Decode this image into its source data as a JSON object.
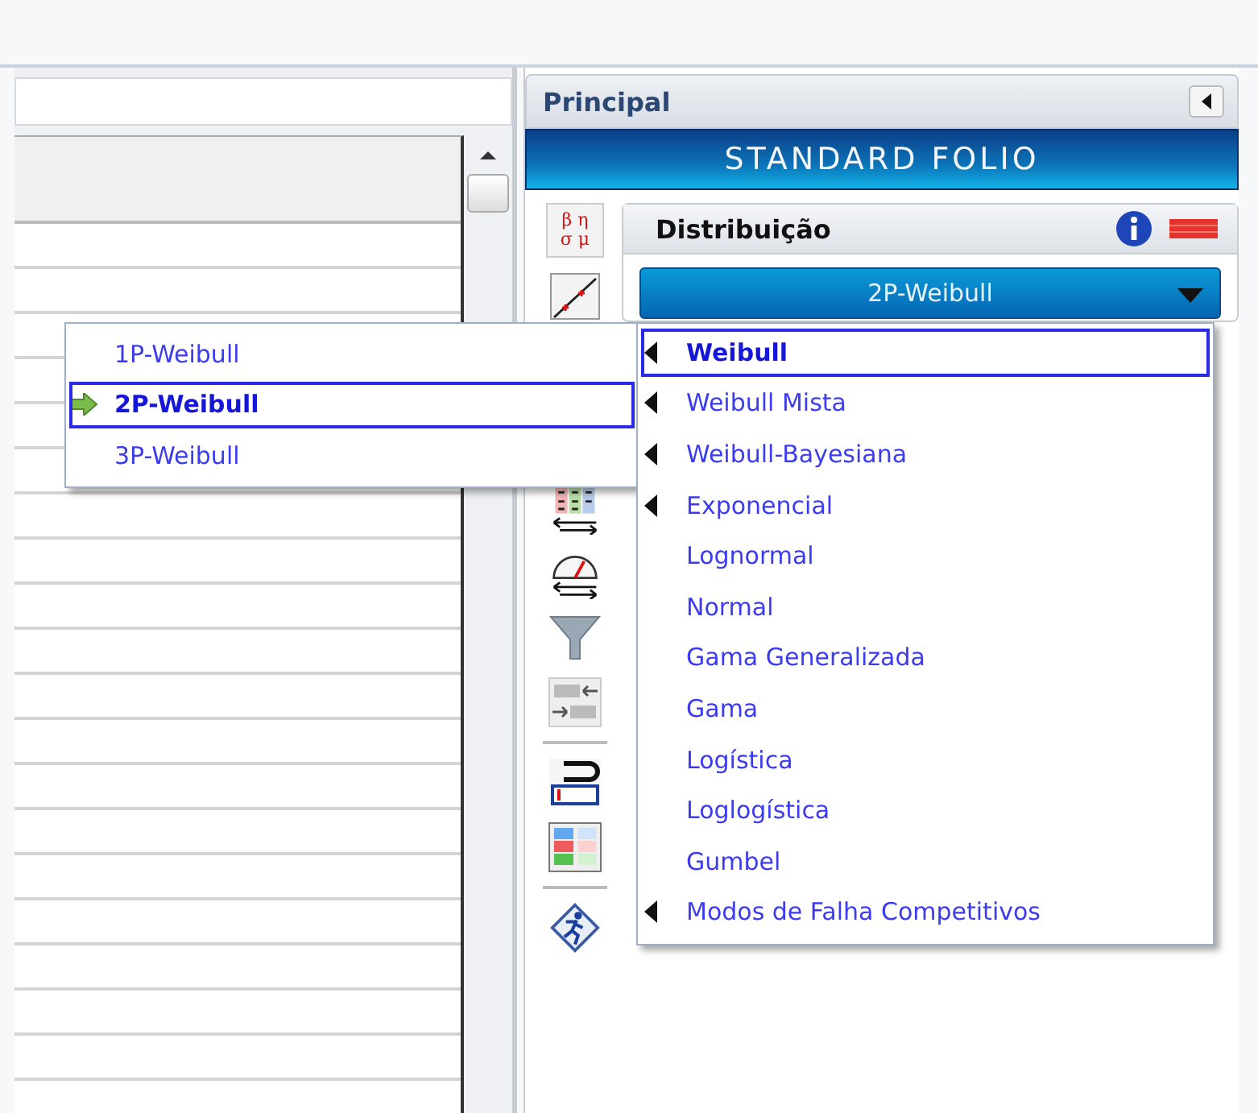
{
  "panel": {
    "title": "Principal",
    "banner": "STANDARD FOLIO"
  },
  "tools": [
    {
      "kind": "params",
      "lines": [
        "β η",
        "σ μ"
      ]
    },
    {
      "kind": "plot"
    },
    {
      "kind": "table-arrows"
    },
    {
      "kind": "gauge"
    },
    {
      "kind": "funnel"
    },
    {
      "kind": "convert"
    },
    {
      "kind": "separator"
    },
    {
      "kind": "bracket"
    },
    {
      "kind": "colored-table"
    },
    {
      "kind": "separator"
    },
    {
      "kind": "runner"
    }
  ],
  "distribution": {
    "title": "Distribuição",
    "value": "2P-Weibull"
  },
  "menu": [
    {
      "label": "Weibull",
      "has_submenu": true,
      "selected": true
    },
    {
      "label": "Weibull Mista",
      "has_submenu": true,
      "selected": false
    },
    {
      "label": "Weibull-Bayesiana",
      "has_submenu": true,
      "selected": false
    },
    {
      "label": "Exponencial",
      "has_submenu": true,
      "selected": false
    },
    {
      "label": "Lognormal",
      "has_submenu": false,
      "selected": false
    },
    {
      "label": "Normal",
      "has_submenu": false,
      "selected": false
    },
    {
      "label": "Gama Generalizada",
      "has_submenu": false,
      "selected": false
    },
    {
      "label": "Gama",
      "has_submenu": false,
      "selected": false
    },
    {
      "label": "Logística",
      "has_submenu": false,
      "selected": false
    },
    {
      "label": "Loglogística",
      "has_submenu": false,
      "selected": false
    },
    {
      "label": "Gumbel",
      "has_submenu": false,
      "selected": false
    },
    {
      "label": "Modos de Falha Competitivos",
      "has_submenu": true,
      "selected": false
    }
  ],
  "submenu": [
    {
      "label": "1P-Weibull",
      "selected": false
    },
    {
      "label": "2P-Weibull",
      "selected": true
    },
    {
      "label": "3P-Weibull",
      "selected": false
    }
  ]
}
